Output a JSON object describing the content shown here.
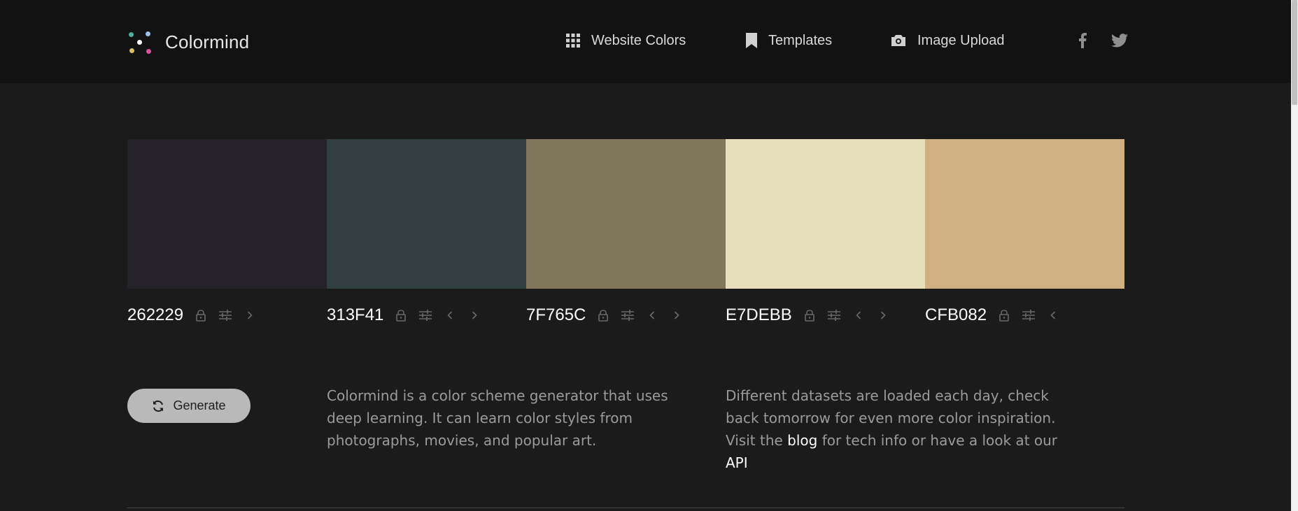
{
  "app": {
    "name": "Colormind"
  },
  "nav": [
    {
      "label": "Website Colors",
      "icon": "grid-icon"
    },
    {
      "label": "Templates",
      "icon": "bookmark-icon"
    },
    {
      "label": "Image Upload",
      "icon": "camera-icon"
    }
  ],
  "social": [
    {
      "icon": "facebook-icon"
    },
    {
      "icon": "twitter-icon"
    }
  ],
  "palette": [
    {
      "hex": "262229",
      "color": "#262229"
    },
    {
      "hex": "313F41",
      "color": "#313F41"
    },
    {
      "hex": "7F765C",
      "color": "#7F765C"
    },
    {
      "hex": "E7DEBB",
      "color": "#E7DEBB"
    },
    {
      "hex": "CFB082",
      "color": "#CFB082"
    }
  ],
  "generate_label": "Generate",
  "about": {
    "text": "Colormind is a color scheme generator that uses deep learning. It can learn color styles from photographs, movies, and popular art."
  },
  "daily": {
    "text_before": "Different datasets are loaded each day, check back tomorrow for even more color inspiration. Visit the",
    "blog_link": "blog",
    "text_middle": "for tech info or have a look at our",
    "api_link": "API"
  },
  "colors": {
    "header_bg": "#121212",
    "page_bg": "#1b1b1b",
    "button_bg": "#b9b9b9",
    "muted_text": "#9b9b9b",
    "logo_dots": [
      "#4fb0a0",
      "#9fc2e6",
      "#ffffff",
      "#d8c25a",
      "#d9559c"
    ]
  }
}
